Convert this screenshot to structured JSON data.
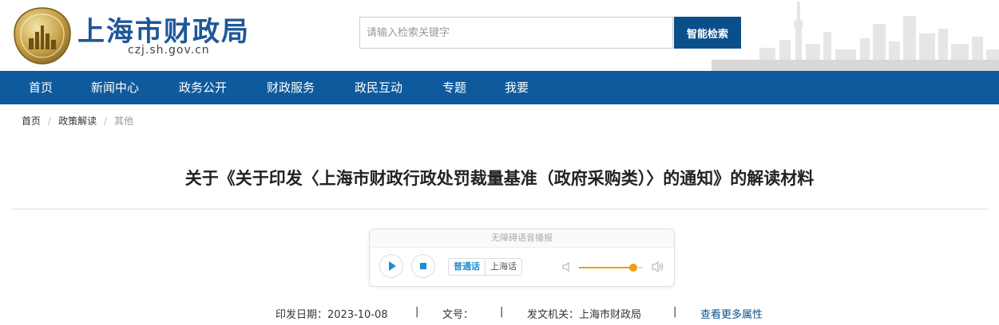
{
  "header": {
    "site_name": "上海市财政局",
    "site_domain": "czj.sh.gov.cn",
    "search_placeholder": "请输入检索关键字",
    "search_button": "智能检索"
  },
  "nav": {
    "items": [
      "首页",
      "新闻中心",
      "政务公开",
      "财政服务",
      "政民互动",
      "专题",
      "我要"
    ]
  },
  "breadcrumb": {
    "items": [
      "首页",
      "政策解读",
      "其他"
    ]
  },
  "article": {
    "title": "关于《关于印发〈上海市财政行政处罚裁量基准（政府采购类）〉的通知》的解读材料"
  },
  "player": {
    "title": "无障碍语音播报",
    "lang_mandarin": "普通话",
    "lang_shanghai": "上海话",
    "volume": 0.85
  },
  "meta": {
    "date_label": "印发日期：",
    "date_value": "2023-10-08",
    "doc_no_label": "文号：",
    "doc_no_value": "",
    "issuer_label": "发文机关：",
    "issuer_value": "上海市财政局",
    "more_link": "查看更多属性",
    "separator": "|"
  },
  "colors": {
    "brand_blue": "#0e5a9c",
    "button_blue": "#0b4f8a",
    "accent_orange": "#f39c12"
  }
}
